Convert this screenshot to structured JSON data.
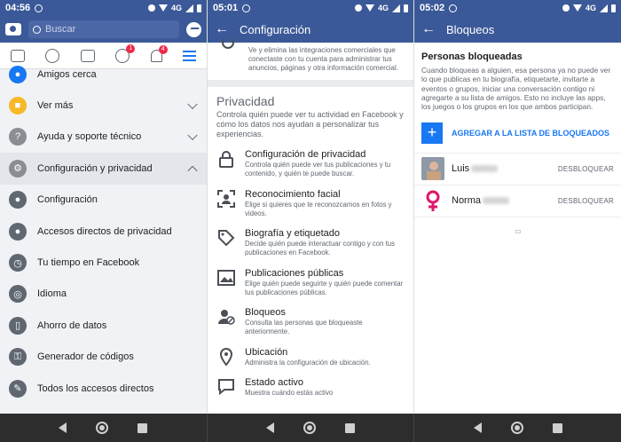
{
  "screen1": {
    "status": {
      "time": "04:56",
      "net": "4G"
    },
    "search_placeholder": "Buscar",
    "tabs": {
      "friends_badge": "1",
      "notifications_badge": "4"
    },
    "menu": [
      {
        "label": "Amigos cerca",
        "icon": "location-pin-icon",
        "color": "#1877f2"
      },
      {
        "label": "Ver más",
        "icon": "squares-icon",
        "color": "#f7b928",
        "chevron": "down"
      },
      {
        "label": "Ayuda y soporte técnico",
        "icon": "question-icon",
        "color": "#8a8d91",
        "chevron": "down"
      },
      {
        "label": "Configuración y privacidad",
        "icon": "gear-icon",
        "color": "#8a8d91",
        "chevron": "up",
        "selected": true
      },
      {
        "label": "Configuración",
        "icon": "person-icon",
        "color": "#606770"
      },
      {
        "label": "Accesos directos de privacidad",
        "icon": "lock-person-icon",
        "color": "#606770"
      },
      {
        "label": "Tu tiempo en Facebook",
        "icon": "clock-icon",
        "color": "#606770"
      },
      {
        "label": "Idioma",
        "icon": "globe-icon",
        "color": "#606770"
      },
      {
        "label": "Ahorro de datos",
        "icon": "phone-icon",
        "color": "#606770"
      },
      {
        "label": "Generador de códigos",
        "icon": "key-icon",
        "color": "#606770"
      },
      {
        "label": "Todos los accesos directos",
        "icon": "pencil-icon",
        "color": "#606770"
      }
    ]
  },
  "screen2": {
    "status": {
      "time": "05:01",
      "net": "4G"
    },
    "title": "Configuración",
    "partial_desc": "Ve y elimina las integraciones comerciales que conectaste con tu cuenta para administrar tus anuncios, páginas y otra información comercial.",
    "section_title": "Privacidad",
    "section_desc": "Controla quién puede ver tu actividad en Facebook y cómo los datos nos ayudan a personalizar tus experiencias.",
    "items": [
      {
        "title": "Configuración de privacidad",
        "desc": "Controla quién puede ver tus publicaciones y tu contenido, y quién te puede buscar.",
        "icon": "padlock-icon"
      },
      {
        "title": "Reconocimiento facial",
        "desc": "Elige si quieres que te reconozcamos en fotos y videos.",
        "icon": "face-frame-icon"
      },
      {
        "title": "Biografía y etiquetado",
        "desc": "Decide quién puede interactuar contigo y con tus publicaciones en Facebook.",
        "icon": "tag-icon"
      },
      {
        "title": "Publicaciones públicas",
        "desc": "Elige quién puede seguirte y quién puede comentar tus publicaciones públicas.",
        "icon": "picture-icon"
      },
      {
        "title": "Bloqueos",
        "desc": "Consulta las personas que bloqueaste anteriormente.",
        "icon": "blocked-person-icon"
      },
      {
        "title": "Ubicación",
        "desc": "Administra la configuración de ubicación.",
        "icon": "location-icon"
      },
      {
        "title": "Estado activo",
        "desc": "Muestra cuándo estás activo",
        "icon": "chat-bubble-icon"
      }
    ]
  },
  "screen3": {
    "status": {
      "time": "05:02",
      "net": "4G"
    },
    "title": "Bloqueos",
    "heading": "Personas bloqueadas",
    "desc": "Cuando bloqueas a alguien, esa persona ya no puede ver lo que publicas en tu biografía, etiquetarte, invitarte a eventos o grupos, iniciar una conversación contigo ni agregarte a su lista de amigos. Esto no incluye las apps, los juegos o los grupos en los que ambos participan.",
    "add_label": "AGREGAR A LA LISTA DE BLOQUEADOS",
    "blocked": [
      {
        "name": "Luis",
        "action": "DESBLOQUEAR"
      },
      {
        "name": "Norma",
        "action": "DESBLOQUEAR"
      }
    ]
  }
}
